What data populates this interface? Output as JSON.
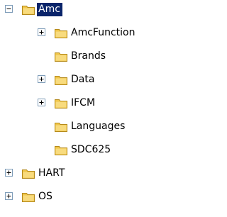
{
  "tree": {
    "nodes": [
      {
        "label": "Amc",
        "expander": "minus",
        "selected": true
      },
      {
        "label": "AmcFunction",
        "expander": "plus",
        "selected": false
      },
      {
        "label": "Brands",
        "expander": "none",
        "selected": false
      },
      {
        "label": "Data",
        "expander": "plus",
        "selected": false
      },
      {
        "label": "IFCM",
        "expander": "plus",
        "selected": false
      },
      {
        "label": "Languages",
        "expander": "none",
        "selected": false
      },
      {
        "label": "SDC625",
        "expander": "none",
        "selected": false
      },
      {
        "label": "HART",
        "expander": "plus",
        "selected": false
      },
      {
        "label": "OS",
        "expander": "plus",
        "selected": false
      }
    ]
  },
  "icons": {
    "folder": "folder-icon",
    "expand": "plus-box-icon",
    "collapse": "minus-box-icon"
  },
  "colors": {
    "selection_background": "#0a246a",
    "selection_text": "#ffffff",
    "folder_body": "#f0c64a",
    "folder_highlight": "#fde9a1",
    "folder_outline": "#b58a1b",
    "expander_border": "#7f9db9"
  }
}
